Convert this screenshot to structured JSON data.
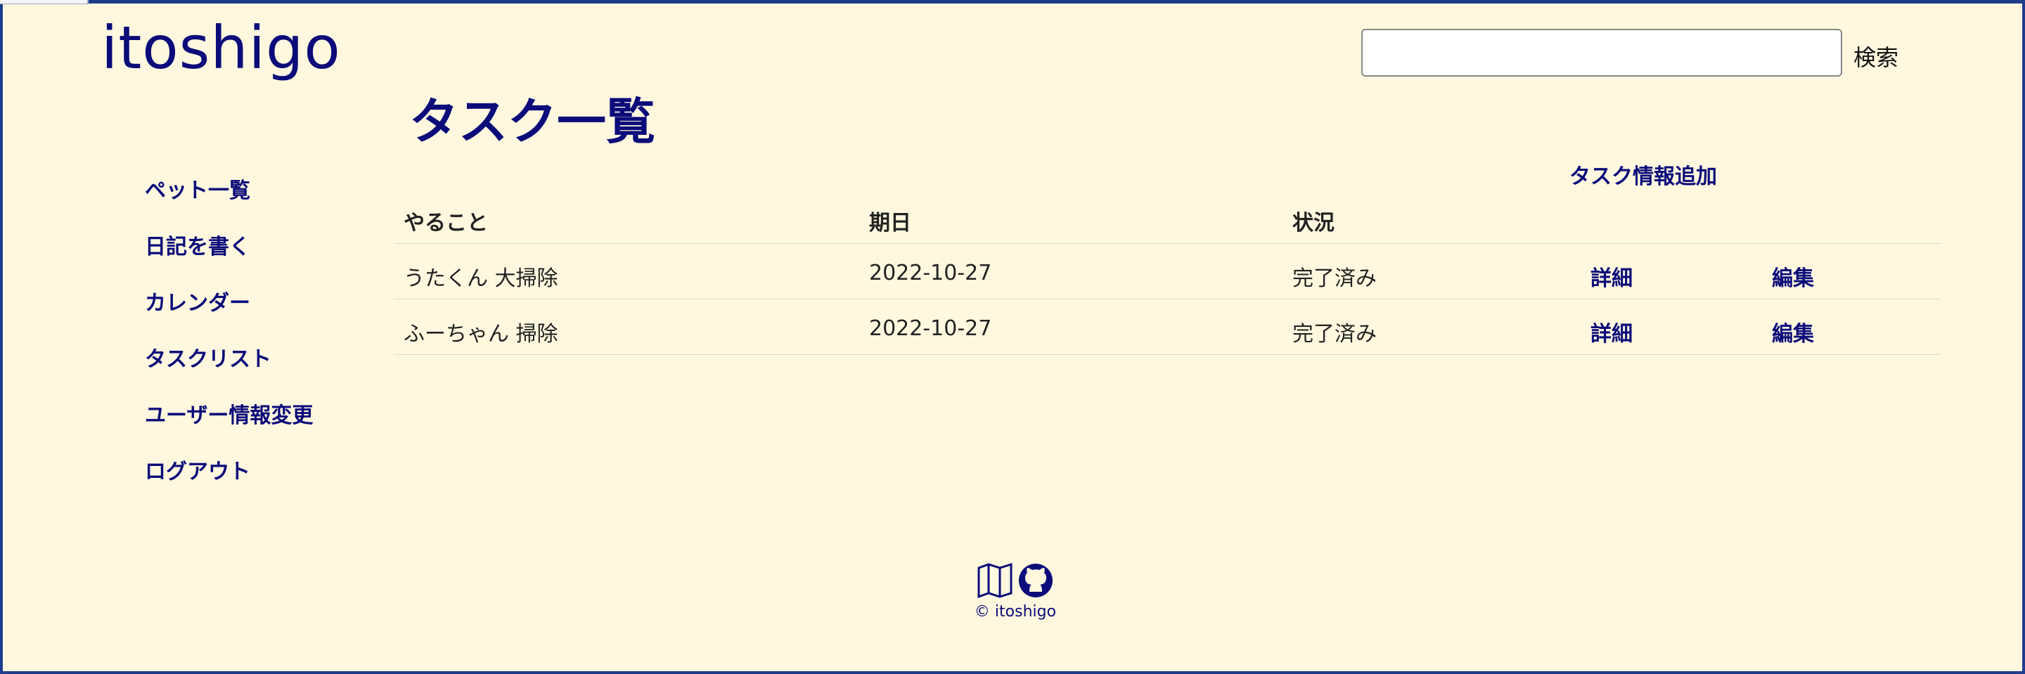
{
  "header": {
    "brand": "itoshigo",
    "search_placeholder": "",
    "search_button": "検索"
  },
  "sidebar": {
    "items": [
      {
        "label": "ペット一覧"
      },
      {
        "label": "日記を書く"
      },
      {
        "label": "カレンダー"
      },
      {
        "label": "タスクリスト"
      },
      {
        "label": "ユーザー情報変更"
      },
      {
        "label": "ログアウト"
      }
    ]
  },
  "main": {
    "title": "タスク一覧",
    "add_link": "タスク情報追加",
    "table": {
      "columns": [
        "やること",
        "期日",
        "状況"
      ],
      "rows": [
        {
          "task": "うたくん 大掃除",
          "due": "2022-10-27",
          "status": "完了済み",
          "detail": "詳細",
          "edit": "編集"
        },
        {
          "task": "ふーちゃん 掃除",
          "due": "2022-10-27",
          "status": "完了済み",
          "detail": "詳細",
          "edit": "編集"
        }
      ]
    }
  },
  "footer": {
    "icons": [
      "map-icon",
      "github-icon"
    ],
    "copyright": "© itoshigo"
  },
  "colors": {
    "background": "#fff8df",
    "accent": "#0b0b7a",
    "border": "#1e3c8c"
  }
}
